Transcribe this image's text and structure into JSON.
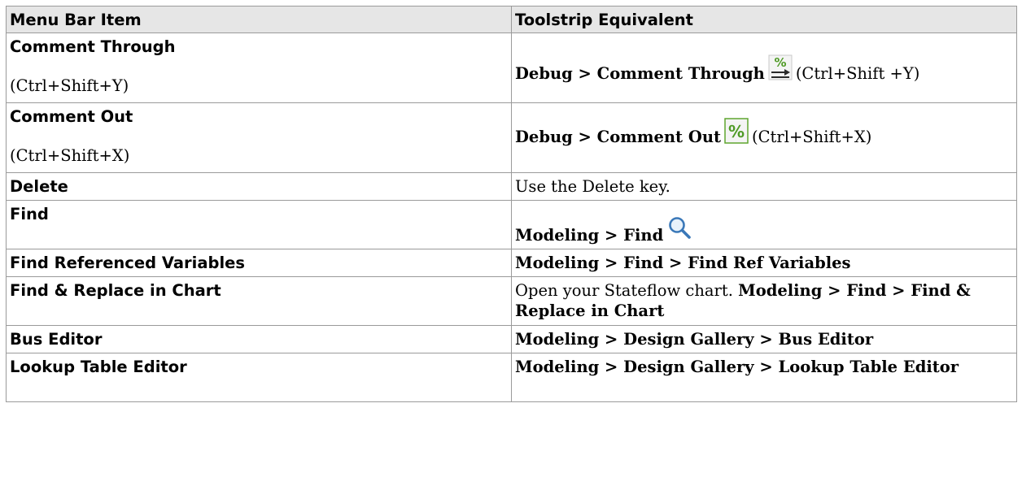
{
  "headers": {
    "menu": "Menu Bar Item",
    "toolstrip": "Toolstrip Equivalent"
  },
  "rows": [
    {
      "menu_label": "Comment Through",
      "menu_shortcut": "(Ctrl+Shift+Y)",
      "tool_path": "Debug > Comment Through",
      "icon": "comment-through-icon",
      "tool_shortcut": "(Ctrl+Shift +Y)"
    },
    {
      "menu_label": "Comment Out",
      "menu_shortcut": "(Ctrl+Shift+X)",
      "tool_path": "Debug > Comment Out",
      "icon": "comment-out-icon",
      "tool_shortcut": "(Ctrl+Shift+X)"
    },
    {
      "menu_label": "Delete",
      "tool_text": "Use the Delete key."
    },
    {
      "menu_label": "Find",
      "tool_path": "Modeling > Find",
      "icon": "magnifier-icon"
    },
    {
      "menu_label": "Find Referenced Variables",
      "tool_path": "Modeling > Find > Find Ref Variables"
    },
    {
      "menu_label": "Find & Replace in Chart",
      "tool_text": "Open your Stateflow chart.",
      "tool_path": "Modeling > Find > Find & Replace in Chart"
    },
    {
      "menu_label": "Bus Editor",
      "tool_path": "Modeling > Design Gallery > Bus Editor"
    },
    {
      "menu_label": "Lookup Table Editor",
      "tool_path": "Modeling > Design Gallery > Lookup Table Editor"
    }
  ],
  "colors": {
    "header_bg": "#e6e6e6",
    "border": "#9a9a9a",
    "icon_green": "#5fa52f"
  }
}
